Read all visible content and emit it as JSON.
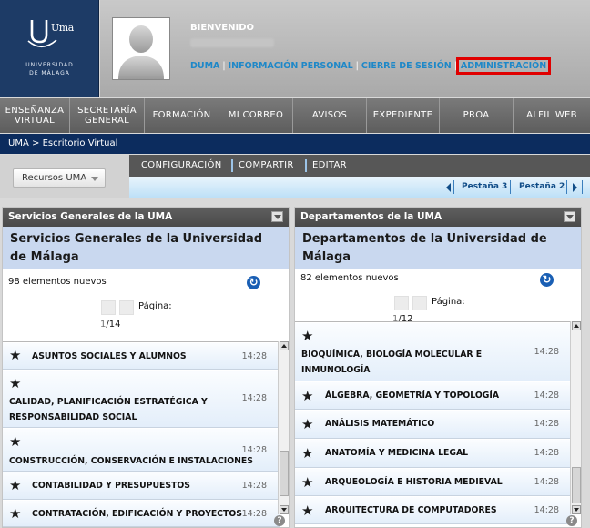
{
  "brand": {
    "logo_text": "Uma",
    "line1": "UNIVERSIDAD",
    "line2": "DE MÁLAGA"
  },
  "header": {
    "welcome": "BIENVENIDO",
    "links": [
      {
        "label": "DUMA"
      },
      {
        "label": "INFORMACIÓN PERSONAL"
      },
      {
        "label": "CIERRE DE SESIÓN"
      },
      {
        "label": "ADMINISTRACIÓN"
      }
    ]
  },
  "nav": {
    "items": [
      {
        "label": "ENSEÑANZA VIRTUAL"
      },
      {
        "label": "SECRETARÍA GENERAL"
      },
      {
        "label": "FORMACIÓN"
      },
      {
        "label": "MI CORREO"
      },
      {
        "label": "AVISOS"
      },
      {
        "label": "EXPEDIENTE"
      },
      {
        "label": "PROA"
      },
      {
        "label": "ALFIL WEB"
      }
    ]
  },
  "breadcrumb": {
    "root": "UMA",
    "sep": ">",
    "current": "Escritorio Virtual"
  },
  "toolbar": {
    "dropdown": "Recursos UMA",
    "actions": [
      "CONFIGURACIÓN",
      "COMPARTIR",
      "EDITAR"
    ],
    "tabs": [
      "Pestaña 3",
      "Pestaña 2"
    ]
  },
  "panels": {
    "left": {
      "title": "Servicios Generales de la UMA",
      "heading": "Servicios Generales de la Universidad de Málaga",
      "count": "98 elementos nuevos",
      "page_label": "Página:",
      "page_current": "1",
      "page_total": "/14",
      "items": [
        {
          "name": "ASUNTOS SOCIALES Y ALUMNOS",
          "time": "14:28"
        },
        {
          "name": "CALIDAD, PLANIFICACIÓN ESTRATÉGICA Y RESPONSABILIDAD SOCIAL",
          "time": "14:28"
        },
        {
          "name": "CONSTRUCCIÓN, CONSERVACIÓN E INSTALACIONES",
          "time": "14:28"
        },
        {
          "name": "CONTABILIDAD Y PRESUPUESTOS",
          "time": "14:28"
        },
        {
          "name": "CONTRATACIÓN, EDIFICACIÓN Y PROYECTOS",
          "time": "14:28"
        }
      ]
    },
    "right": {
      "title": "Departamentos de la UMA",
      "heading": "Departamentos de la Universidad de Málaga",
      "count": "82 elementos nuevos",
      "page_label": "Página:",
      "page_current": "1",
      "page_total": "/12",
      "items": [
        {
          "name": "BIOQUÍMICA, BIOLOGÍA MOLECULAR E INMUNOLOGÍA",
          "time": "14:28"
        },
        {
          "name": "ÁLGEBRA, GEOMETRÍA Y TOPOLOGÍA",
          "time": "14:28"
        },
        {
          "name": "ANÁLISIS MATEMÁTICO",
          "time": "14:28"
        },
        {
          "name": "ANATOMÍA Y MEDICINA LEGAL",
          "time": "14:28"
        },
        {
          "name": "ARQUEOLOGÍA E HISTORIA MEDIEVAL",
          "time": "14:28"
        },
        {
          "name": "ARQUITECTURA DE COMPUTADORES",
          "time": "14:28"
        }
      ]
    }
  },
  "colors": {
    "brand_navy": "#1d3b66",
    "breadcrumb_bg": "#0c2c5e",
    "link_blue": "#1e88c8",
    "highlight_red": "#e00000",
    "panel_heading_bg": "#c9d8ef"
  }
}
